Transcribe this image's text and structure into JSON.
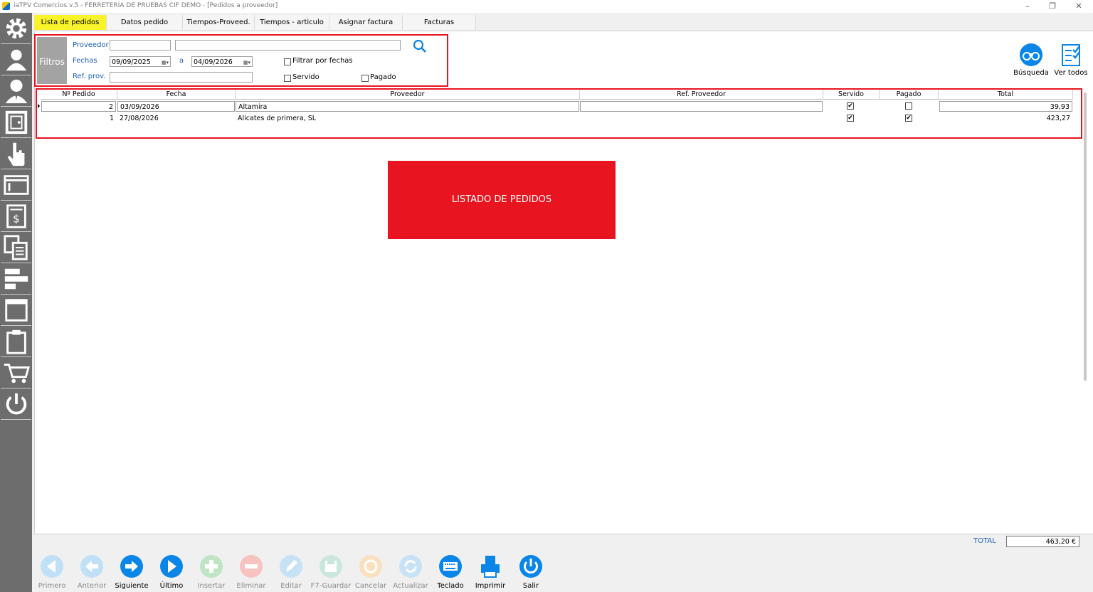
{
  "window": {
    "title": "iaTPV Comercios v.5 - FERRETERÍA DE PRUEBAS CIF DEMO - [Pedidos a proveedor]",
    "controls": [
      "–",
      "❐",
      "✕"
    ]
  },
  "sidebar": {
    "icons": [
      "gear-icon",
      "customer-icon",
      "user-icon",
      "safe-icon",
      "hand-pointer-icon",
      "screen-icon",
      "invoice-icon",
      "documents-icon",
      "layout-icon",
      "window-icon",
      "clipboard-icon",
      "cart-icon",
      "power-icon"
    ]
  },
  "tabs": [
    {
      "label": "Lista de pedidos",
      "active": true
    },
    {
      "label": "Datos pedido"
    },
    {
      "label": "Tiempos-Proveed."
    },
    {
      "label": "Tiempos - articulo"
    },
    {
      "label": "Asignar factura"
    },
    {
      "label": "Facturas"
    }
  ],
  "filters": {
    "title": "Filtros",
    "proveedor_label": "Proveedor",
    "proveedor_code": "",
    "proveedor_name": "",
    "fechas_label": "Fechas",
    "date_from": "09/09/2025",
    "a_label": "a",
    "date_to": "04/09/2026",
    "ref_label": "Ref. prov.",
    "ref_value": "",
    "filtrar_label": "Filtrar por fechas",
    "filtrar_checked": false,
    "servido_label": "Servido",
    "servido_checked": false,
    "pagado_label": "Pagado",
    "pagado_checked": false
  },
  "tools": {
    "busqueda": "Búsqueda",
    "ver_todos": "Ver todos"
  },
  "grid": {
    "headers": [
      "Nº Pedido",
      "Fecha",
      "Proveedor",
      "Ref. Proveedor",
      "Servido",
      "Pagado",
      "Total"
    ],
    "rows": [
      {
        "num": "2",
        "fecha": "03/09/2026",
        "proveedor": "Altamira",
        "ref": "",
        "servido": true,
        "pagado": false,
        "total": "39,93"
      },
      {
        "num": "1",
        "fecha": "27/08/2026",
        "proveedor": "Alicates de primera, SL",
        "ref": "",
        "servido": true,
        "pagado": true,
        "total": "423,27"
      }
    ]
  },
  "banner": "LISTADO DE PEDIDOS",
  "total": {
    "label": "TOTAL",
    "value": "463,20 €"
  },
  "bottom": [
    {
      "label": "Primero",
      "enabled": false
    },
    {
      "label": "Anterior",
      "enabled": false
    },
    {
      "label": "Siguiente",
      "enabled": true
    },
    {
      "label": "Último",
      "enabled": true
    },
    {
      "label": "Insertar",
      "enabled": false
    },
    {
      "label": "Eliminar",
      "enabled": false
    },
    {
      "label": "Editar",
      "enabled": false
    },
    {
      "label": "F7-Guardar",
      "enabled": false
    },
    {
      "label": "Cancelar",
      "enabled": false
    },
    {
      "label": "Actualizar",
      "enabled": false
    },
    {
      "label": "Teclado",
      "enabled": true
    },
    {
      "label": "Imprimir",
      "enabled": true
    },
    {
      "label": "Salir",
      "enabled": true
    }
  ],
  "colors": {
    "highlight": "#e8141f",
    "active_tab": "#f8f32b",
    "label_blue": "#1d5fba",
    "button_blue": "#0a85e8"
  }
}
